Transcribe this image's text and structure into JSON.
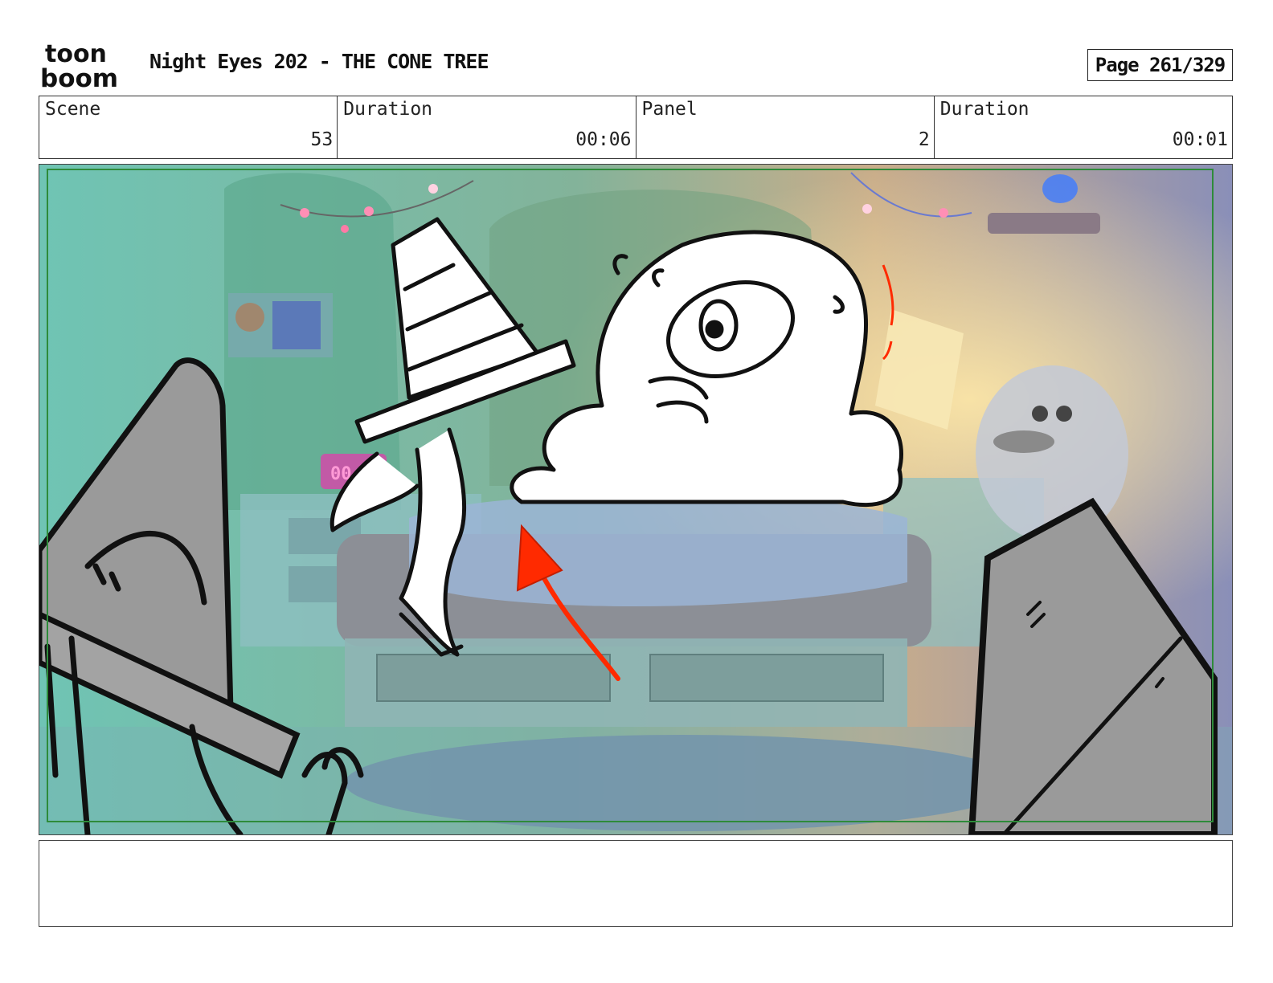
{
  "header": {
    "logo_top": "toon",
    "logo_bottom": "boom",
    "title": "Night Eyes 202 - THE CONE TREE",
    "page": "Page 261/329"
  },
  "info": {
    "scene_label": "Scene",
    "scene_value": "53",
    "duration_label": "Duration",
    "duration_value": "00:06",
    "panel_label": "Panel",
    "panel_value": "2",
    "panel_duration_label": "Duration",
    "panel_duration_value": "00:01"
  },
  "panel_art": {
    "clock_text": "00:00",
    "colors": {
      "wall": "#7fb9a7",
      "bed_shadow": "#8c8f96",
      "rug": "#6f86a8",
      "red_arrow": "#ff2a00",
      "cone_gray": "#9a9a9a",
      "safe_area": "#2e8b3a"
    }
  },
  "notes": {
    "text": ""
  }
}
